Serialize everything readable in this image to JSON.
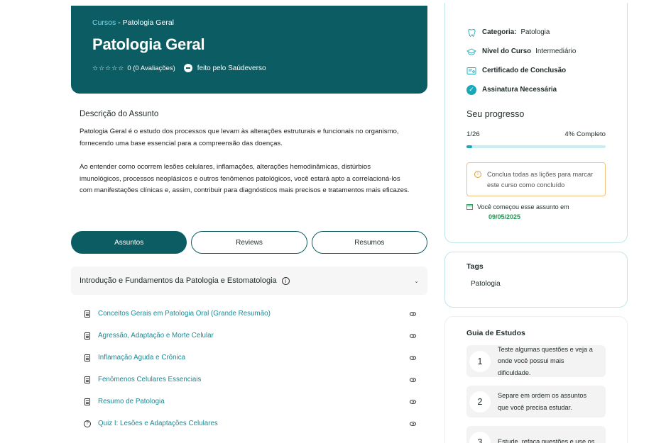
{
  "hero": {
    "breadcrumb_link": "Cursos",
    "breadcrumb_sep": " - ",
    "breadcrumb_current": "Patologia Geral",
    "title": "Patologia Geral",
    "stars": "☆☆☆☆☆",
    "rating_text": "0 (0 Avaliações)",
    "made_by": "feito pelo Saúdeverso"
  },
  "description": {
    "heading": "Descrição do Assunto",
    "paragraph1": "Patologia Geral é o estudo dos processos que levam às alterações estruturais e funcionais no organismo, fornecendo uma base essencial para a compreensão das doenças.",
    "paragraph2": "Ao entender como ocorrem lesões celulares, inflamações, alterações hemodinâmicas, distúrbios imunológicos, processos neoplásicos e outros fenômenos patológicos, você estará apto a correlacioná-los com manifestações clínicas e, assim, contribuir para diagnósticos mais precisos e tratamentos mais eficazes."
  },
  "tabs": [
    {
      "label": "Assuntos",
      "active": true
    },
    {
      "label": "Reviews",
      "active": false
    },
    {
      "label": "Resumos",
      "active": false
    }
  ],
  "accordion": {
    "title": "Introdução e Fundamentos da Patologia e Estomatologia",
    "info_icon": "i",
    "chevron": "⌄"
  },
  "lessons": [
    {
      "label": "Conceitos Gerais em Patologia Oral (Grande Resumão)",
      "icon": "document-icon"
    },
    {
      "label": "Agressão, Adaptação e Morte Celular",
      "icon": "document-icon"
    },
    {
      "label": "Inflamação Aguda e Crônica",
      "icon": "document-icon"
    },
    {
      "label": "Fenômenos Celulares Essenciais",
      "icon": "document-icon"
    },
    {
      "label": "Resumo de Patologia",
      "icon": "document-icon"
    },
    {
      "label": "Quiz I: Lesões e Adaptações Celulares",
      "icon": "quiz-icon",
      "icon_glyph": "?"
    }
  ],
  "info_card": {
    "category_label": "Categoria:",
    "category_value": "Patologia",
    "level_label": "Nível do Curso",
    "level_value": "Intermediário",
    "certificate_label": "Certificado de Conclusão",
    "subscription_label": "Assinatura Necessária",
    "check_glyph": "✓",
    "progress_title": "Seu progresso",
    "progress_count": "1/26",
    "progress_percent_text": "4% Completo",
    "progress_fraction": 0.04,
    "notice_icon": "i",
    "notice_text": "Conclua todas as lições para marcar este curso como concluído",
    "started_text": "Você começou esse assunto em",
    "started_date": "09/05/2025"
  },
  "tags_card": {
    "title": "Tags",
    "tags": [
      "Patologia"
    ]
  },
  "guide_card": {
    "title": "Guia de Estudos",
    "steps": [
      {
        "num": "1",
        "text": "Teste algumas questões e veja a onde você possui mais dificuldade."
      },
      {
        "num": "2",
        "text": "Separe em ordem os assuntos que você precisa estudar."
      },
      {
        "num": "3",
        "text": "Estude, refaça questões e use os"
      }
    ]
  },
  "colors": {
    "brand": "#0b5d63",
    "accent": "#1aa7b8",
    "link": "#1a8a94",
    "success": "#1a9a50",
    "warning": "#f0c27a"
  },
  "icons": [
    "tooth-icon",
    "level-icon",
    "certificate-icon",
    "check-icon",
    "info-icon",
    "eye-icon",
    "document-icon",
    "quiz-icon",
    "calendar-icon",
    "chevron-down-icon",
    "logo-icon"
  ]
}
